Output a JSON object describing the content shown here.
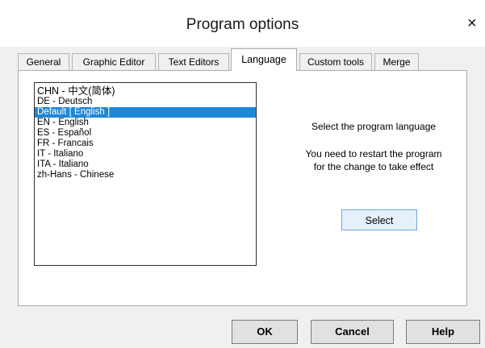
{
  "window": {
    "title": "Program options",
    "close_glyph": "×"
  },
  "tabs": [
    {
      "label": "General"
    },
    {
      "label": "Graphic Editor"
    },
    {
      "label": "Text Editors"
    },
    {
      "label": "Language",
      "active": true
    },
    {
      "label": "Custom tools"
    },
    {
      "label": "Merge"
    }
  ],
  "language_list": {
    "items": [
      "CHN - 中文(简体)",
      "DE - Deutsch",
      "Default [ English ]",
      "EN - English",
      "ES - Español",
      "FR - Francais",
      "IT - Italiano",
      "ITA - Italiano",
      "zh-Hans - Chinese"
    ],
    "selected": "Default [ English ]"
  },
  "info": {
    "prompt": "Select the program language",
    "restart_line1": "You need to restart the program",
    "restart_line2": "for the change to take effect"
  },
  "buttons": {
    "select": "Select",
    "ok": "OK",
    "cancel": "Cancel",
    "help": "Help"
  },
  "colors": {
    "selection": "#1f87d8",
    "dialog_bg": "#f0f0f0",
    "select_button_bg": "#e6f0fa"
  }
}
